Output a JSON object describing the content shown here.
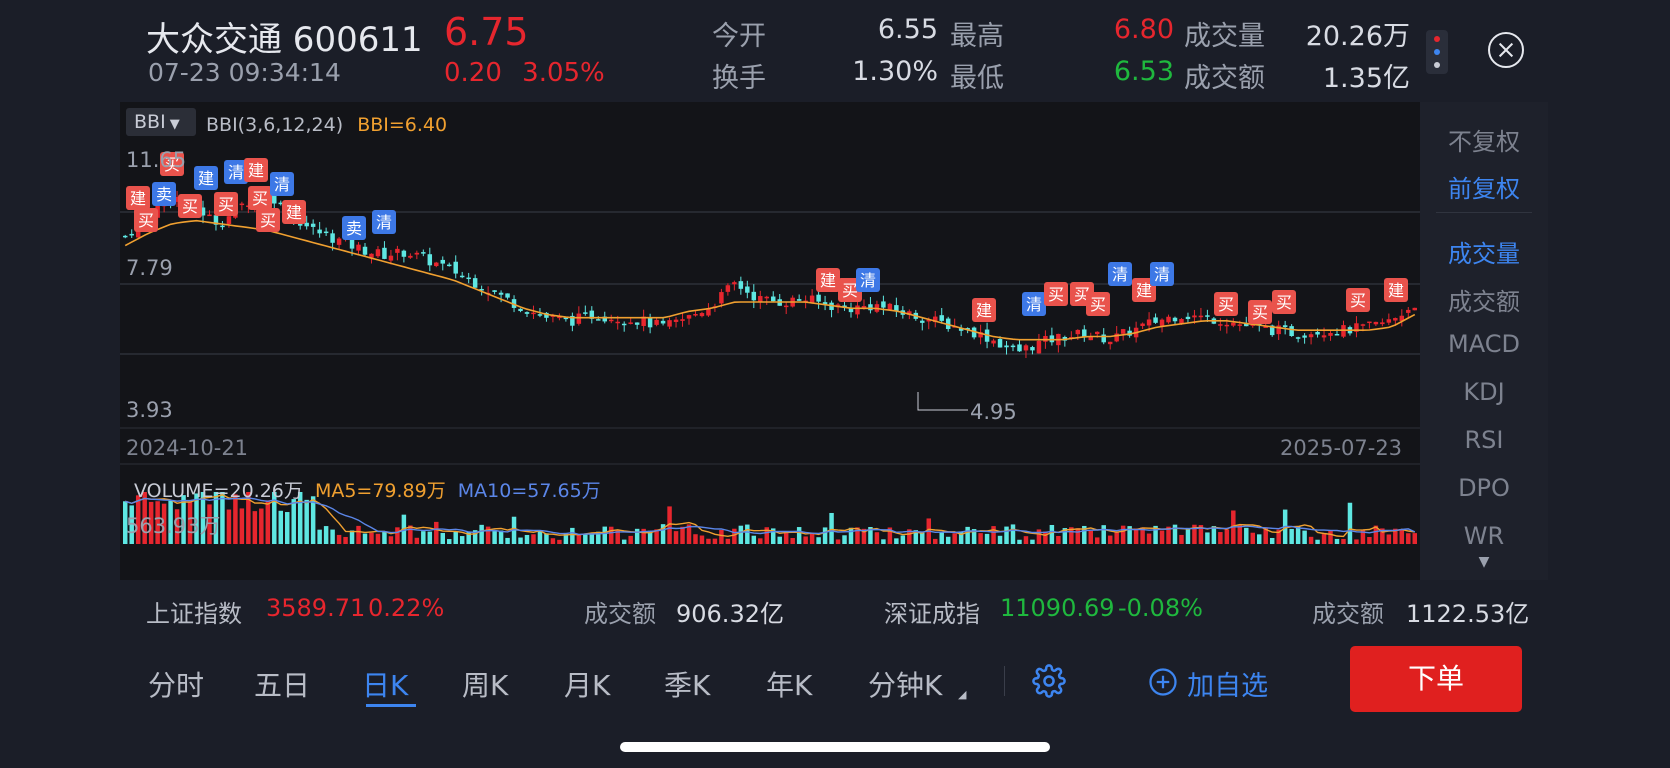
{
  "header": {
    "title": "大众交通 600611",
    "datetime": "07-23 09:34:14",
    "price": "6.75",
    "change": "0.20",
    "change_pct": "3.05%",
    "open_label": "今开",
    "open_value": "6.55",
    "high_label": "最高",
    "high_value": "6.80",
    "volume_label": "成交量",
    "volume_value": "20.26万",
    "turnover_rate_label": "换手",
    "turnover_rate_value": "1.30%",
    "low_label": "最低",
    "low_value": "6.53",
    "amount_label": "成交额",
    "amount_value": "1.35亿"
  },
  "indicator": {
    "selector_label": "BBI",
    "params": "BBI(3,6,12,24)",
    "value": "BBI=6.40"
  },
  "kline": {
    "ytop": "11.65",
    "ymid": "7.79",
    "ylow": "3.93",
    "min_marker": "4.95",
    "date_start": "2024-10-21",
    "date_end": "2025-07-23"
  },
  "volume_panel": {
    "vol_label": "VOLUME=20.26万",
    "ma5_label": "MA5=79.89万",
    "ma10_label": "MA10=57.65万",
    "ymax": "563.93万"
  },
  "right_panel": {
    "items": [
      "不复权",
      "前复权",
      "成交量",
      "成交额",
      "MACD",
      "KDJ",
      "RSI",
      "DPO",
      "WR"
    ],
    "active": [
      "前复权",
      "成交量"
    ]
  },
  "index_bar": {
    "sh_label": "上证指数",
    "sh_value": "3589.71",
    "sh_pct": "0.22%",
    "sh_amount_label": "成交额",
    "sh_amount": "906.32亿",
    "sz_label": "深证成指",
    "sz_value": "11090.69",
    "sz_pct": "-0.08%",
    "sz_amount_label": "成交额",
    "sz_amount": "1122.53亿"
  },
  "tabs": [
    "分时",
    "五日",
    "日K",
    "周K",
    "月K",
    "季K",
    "年K",
    "分钟K"
  ],
  "active_tab": "日K",
  "actions": {
    "watchlist_label": "加自选",
    "order_label": "下单"
  },
  "signal_tags": {
    "buy": "买",
    "sell": "卖",
    "build": "建",
    "clear": "清"
  },
  "colors": {
    "up": "#e6262e",
    "down": "#5ee7e2",
    "accent": "#3d85f0",
    "bbi": "#f0a030",
    "ma10": "#5b86e8",
    "order": "#e0201f"
  },
  "chart_data": {
    "type": "candlestick",
    "x_range": [
      "2024-10-21",
      "2025-07-23"
    ],
    "ylim": [
      3.93,
      11.65
    ],
    "close_profile": [
      8.9,
      9.6,
      10.2,
      9.8,
      9.3,
      9.9,
      10.4,
      9.6,
      9.1,
      8.8,
      8.5,
      8.3,
      8.4,
      8.1,
      7.8,
      7.4,
      7.0,
      6.6,
      6.3,
      6.2,
      6.4,
      6.3,
      6.2,
      6.0,
      6.3,
      6.7,
      7.4,
      6.9,
      6.8,
      6.9,
      6.7,
      6.6,
      6.7,
      6.5,
      6.3,
      6.1,
      5.9,
      5.6,
      5.2,
      5.5,
      5.7,
      5.8,
      5.6,
      5.9,
      6.2,
      6.4,
      6.3,
      6.2,
      6.0,
      5.9,
      5.8,
      5.9,
      5.9,
      6.0,
      6.2,
      6.75
    ],
    "bbi_profile": [
      8.6,
      9.0,
      9.3,
      9.4,
      9.3,
      9.2,
      9.1,
      8.9,
      8.7,
      8.5,
      8.3,
      8.1,
      7.9,
      7.7,
      7.5,
      7.2,
      6.9,
      6.6,
      6.4,
      6.3,
      6.3,
      6.3,
      6.3,
      6.3,
      6.5,
      6.6,
      6.8,
      6.8,
      6.8,
      6.8,
      6.7,
      6.6,
      6.6,
      6.5,
      6.3,
      6.1,
      5.9,
      5.7,
      5.6,
      5.6,
      5.6,
      5.7,
      5.7,
      5.8,
      6.0,
      6.1,
      6.2,
      6.2,
      6.1,
      6.0,
      5.9,
      5.9,
      5.9,
      5.9,
      6.0,
      6.4
    ],
    "min_point": 4.95,
    "volume_ymax": 563.93,
    "volume_unit": "万",
    "last_volume": 20.26,
    "ma5": 79.89,
    "ma10": 57.65
  }
}
